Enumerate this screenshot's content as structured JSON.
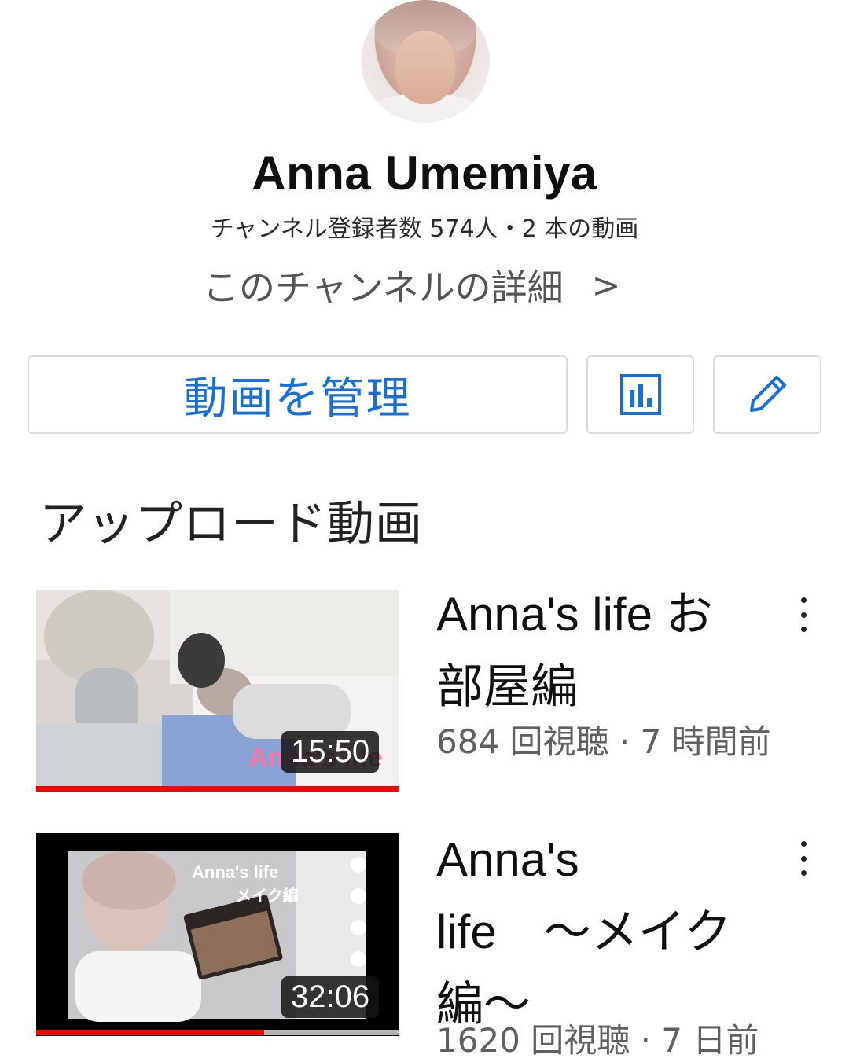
{
  "channel": {
    "name": "Anna Umemiya",
    "stats": "チャンネル登録者数 574人・2 本の動画",
    "details_link": "このチャンネルの詳細",
    "details_chevron": ">"
  },
  "actions": {
    "manage_videos": "動画を管理",
    "analytics_icon": "analytics-icon",
    "edit_icon": "pencil-icon"
  },
  "uploads": {
    "section_title": "アップロード動画",
    "videos": [
      {
        "title_line1": "Anna's life お",
        "title_line2": "部屋編",
        "meta": "684 回視聴 · 7 時間前",
        "duration": "15:50",
        "watermark": "Anna's life",
        "progress": 1.0
      },
      {
        "title_line1": "Anna's",
        "title_line2": "life　～メイク",
        "title_line3": "編～",
        "meta": "1620 回視聴 · 7 日前",
        "duration": "32:06",
        "thumb_text_line1": "Anna's life",
        "thumb_text_line2": "メイク編",
        "progress": 0.63
      }
    ]
  },
  "colors": {
    "accent_blue": "#1a6fd2",
    "progress_red": "#ff0000",
    "progress_track": "#b3b3b3"
  }
}
